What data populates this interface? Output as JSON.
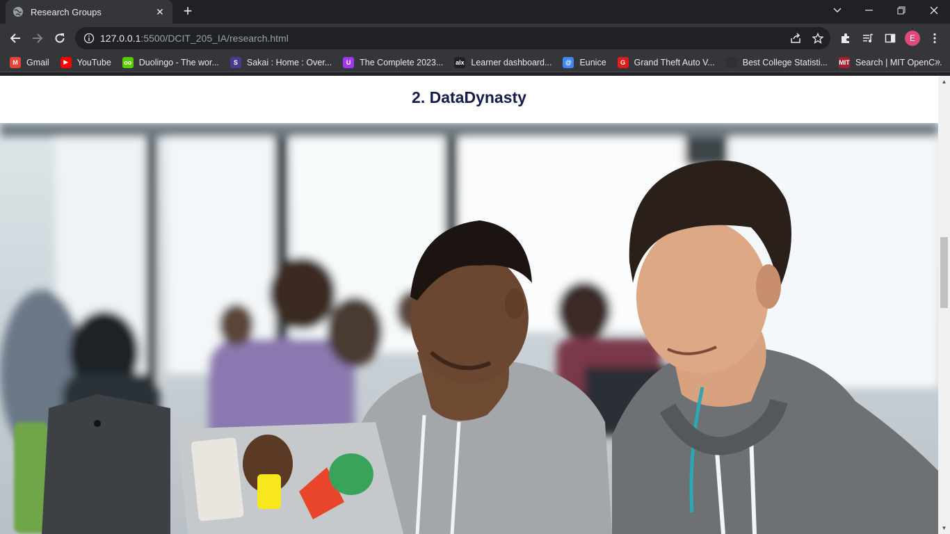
{
  "browser": {
    "tab_title": "Research Groups",
    "url_host": "127.0.0.1",
    "url_path": ":5500/DCIT_205_IA/research.html",
    "profile_initial": "E",
    "bookmarks": [
      {
        "label": "Gmail",
        "icon": "gmail-icon",
        "color": "#ea4335",
        "glyph": "M"
      },
      {
        "label": "YouTube",
        "icon": "youtube-icon",
        "color": "#ff0000",
        "glyph": "▶"
      },
      {
        "label": "Duolingo - The wor...",
        "icon": "duolingo-icon",
        "color": "#58cc02",
        "glyph": "oo"
      },
      {
        "label": "Sakai : Home : Over...",
        "icon": "sakai-icon",
        "color": "#4b3b8f",
        "glyph": "S"
      },
      {
        "label": "The Complete 2023...",
        "icon": "udemy-icon",
        "color": "#a435f0",
        "glyph": "U"
      },
      {
        "label": "Learner dashboard...",
        "icon": "alx-icon",
        "color": "#202124",
        "glyph": "alx"
      },
      {
        "label": "Eunice",
        "icon": "eunice-icon",
        "color": "#4285f4",
        "glyph": "@"
      },
      {
        "label": "Grand Theft Auto V...",
        "icon": "gta-icon",
        "color": "#e01b1b",
        "glyph": "G"
      },
      {
        "label": "Best College Statisti...",
        "icon": "college-icon",
        "color": "#303134",
        "glyph": ""
      },
      {
        "label": "Search | MIT OpenC...",
        "icon": "mit-icon",
        "color": "#a31f34",
        "glyph": "MIT"
      }
    ]
  },
  "page": {
    "heading": "2. DataDynasty",
    "photo_alt": "Students working on laptops"
  },
  "colors": {
    "heading": "#151b4e",
    "chrome_dark": "#202124",
    "chrome_toolbar": "#35363a"
  }
}
